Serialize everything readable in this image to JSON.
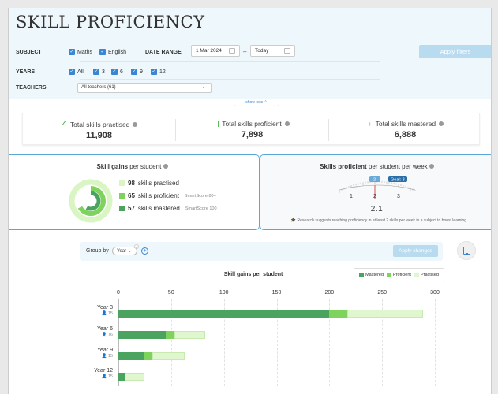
{
  "filters": {
    "title": "SKILL PROFICIENCY",
    "subject_label": "SUBJECT",
    "subjects": [
      {
        "label": "Maths",
        "checked": true
      },
      {
        "label": "English",
        "checked": true
      }
    ],
    "date_range_label": "DATE RANGE",
    "date_from": "1 Mar 2024",
    "date_to": "Today",
    "years_label": "YEARS",
    "years": [
      {
        "label": "All",
        "checked": true
      },
      {
        "label": "3",
        "checked": true
      },
      {
        "label": "6",
        "checked": true
      },
      {
        "label": "9",
        "checked": true
      },
      {
        "label": "12",
        "checked": true
      }
    ],
    "teachers_label": "TEACHERS",
    "teachers_value": "All teachers (61)",
    "apply_label": "Apply filters",
    "show_less_label": "show less"
  },
  "totals": [
    {
      "label": "Total skills practised",
      "value": "11,908",
      "icon": "check-icon"
    },
    {
      "label": "Total skills proficient",
      "value": "7,898",
      "icon": "bookmark-icon"
    },
    {
      "label": "Total skills mastered",
      "value": "6,888",
      "icon": "trophy-icon"
    }
  ],
  "skill_gains": {
    "title_bold": "Skill gains",
    "title_rest": " per student",
    "items": [
      {
        "value": "98",
        "label": "skills practised",
        "sub": "",
        "color": "#d9f5c4"
      },
      {
        "value": "65",
        "label": "skills proficient",
        "sub": "SmartScore 80+",
        "color": "#7ed35c"
      },
      {
        "value": "57",
        "label": "skills mastered",
        "sub": "SmartScore 100",
        "color": "#4aa35f"
      }
    ],
    "ring_fractions": {
      "practised": 1.0,
      "proficient": 0.663,
      "mastered": 0.582
    }
  },
  "skills_proficient": {
    "title_bold": "Skills proficient",
    "title_rest": " per student per week",
    "value": "2.1",
    "goal_label": "Goal: 3",
    "marker_label": "2",
    "scale_labels": [
      "1",
      "2",
      "3"
    ],
    "research_text": "Research suggests reaching proficiency in at least 2 skills per week in a subject to boost learning"
  },
  "chart_controls": {
    "group_by_label": "Group by",
    "group_by_value": "Year",
    "apply_changes_label": "Apply changes"
  },
  "chart_data": {
    "type": "bar",
    "orientation": "horizontal",
    "stacked": true,
    "title": "Skill gains per student",
    "categories": [
      "Year 3",
      "Year 6",
      "Year 9",
      "Year 12"
    ],
    "student_counts": [
      "15",
      "76",
      "15",
      "15"
    ],
    "series": [
      {
        "name": "Mastered",
        "values": [
          200,
          45,
          24,
          6
        ],
        "color": "#4aa35f"
      },
      {
        "name": "Proficient",
        "values": [
          17,
          8,
          8,
          0
        ],
        "color": "#7ed35c"
      },
      {
        "name": "Practised",
        "values": [
          72,
          29,
          31,
          19
        ],
        "color": "#dff6cf"
      }
    ],
    "xlim": [
      0,
      300
    ],
    "xticks": [
      0,
      50,
      100,
      150,
      200,
      250,
      300
    ],
    "grid": true,
    "legend_position": "top-right"
  }
}
